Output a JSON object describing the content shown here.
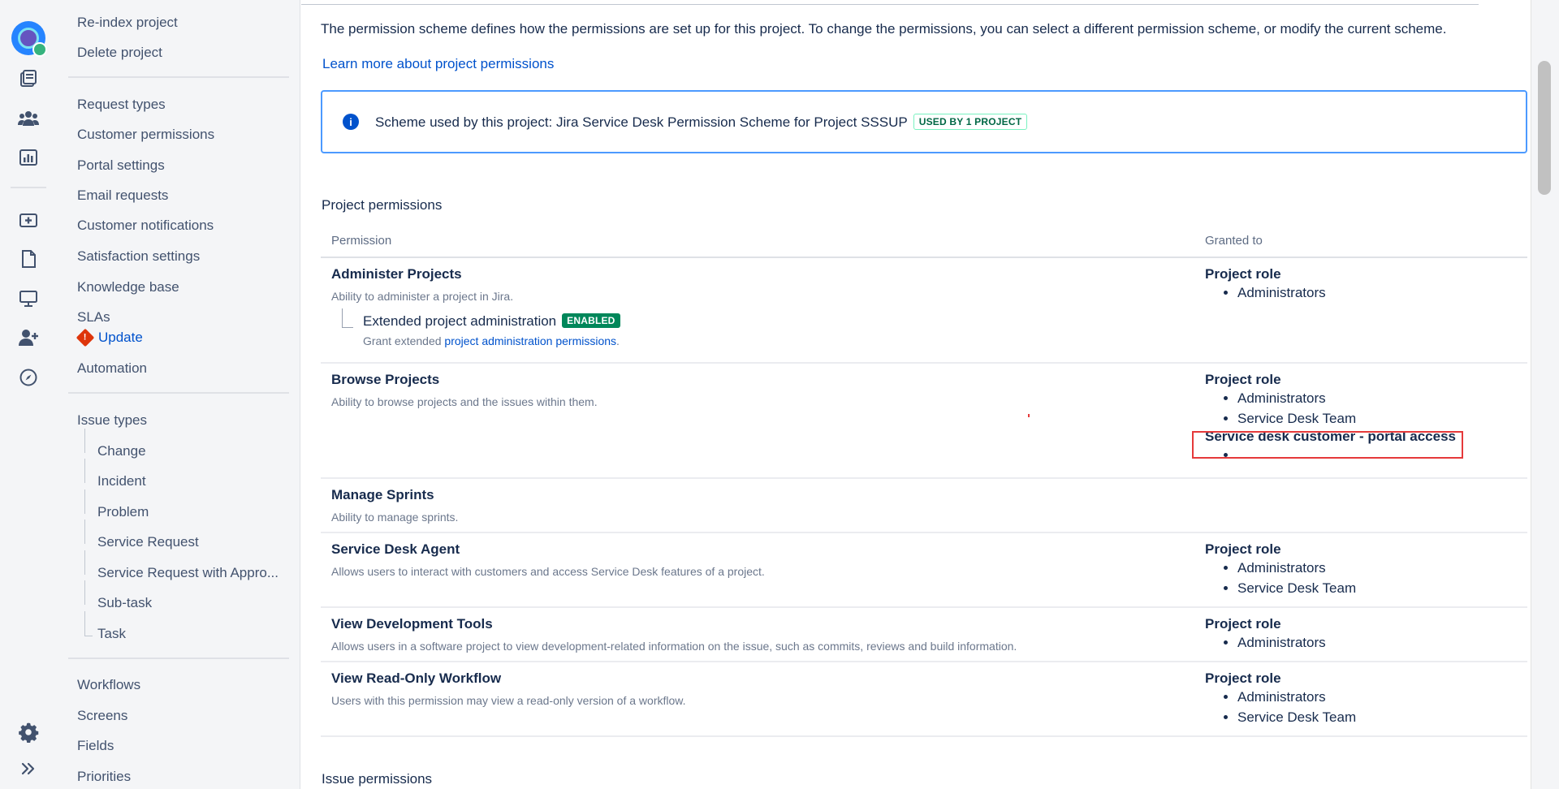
{
  "rail": {
    "icons": [
      "project-avatar-icon",
      "issues-icon",
      "queues-people-icon",
      "reports-icon",
      "add-item-icon",
      "pages-icon",
      "monitor-icon",
      "add-user-icon",
      "compass-icon",
      "settings-gear-icon",
      "expand-sidebar-icon"
    ]
  },
  "sidebar": {
    "reindex": "Re-index project",
    "delete": "Delete project",
    "request_types": "Request types",
    "customer_permissions": "Customer permissions",
    "portal_settings": "Portal settings",
    "email_requests": "Email requests",
    "customer_notifications": "Customer notifications",
    "satisfaction_settings": "Satisfaction settings",
    "knowledge_base": "Knowledge base",
    "slas": "SLAs",
    "update": "Update",
    "automation": "Automation",
    "issue_types": "Issue types",
    "issue_type_items": [
      "Change",
      "Incident",
      "Problem",
      "Service Request",
      "Service Request with Appro...",
      "Sub-task",
      "Task"
    ],
    "workflows": "Workflows",
    "screens": "Screens",
    "fields": "Fields",
    "priorities": "Priorities"
  },
  "main": {
    "description": "The permission scheme defines how the permissions are set up for this project. To change the permissions, you can select a different permission scheme, or modify the current scheme.",
    "learn_more": "Learn more about project permissions",
    "scheme_text": "Scheme used by this project: Jira Service Desk Permission Scheme for Project SSSUP",
    "scheme_badge": "USED BY 1 PROJECT",
    "project_permissions_title": "Project permissions",
    "issue_permissions_title": "Issue permissions",
    "col_permission": "Permission",
    "col_granted": "Granted to",
    "permissions": [
      {
        "name": "Administer Projects",
        "desc": "Ability to administer a project in Jira.",
        "role_label": "Project role",
        "roles": [
          "Administrators"
        ]
      },
      {
        "name": "Browse Projects",
        "desc": "Ability to browse projects and the issues within them.",
        "role_label": "Project role",
        "roles": [
          "Administrators",
          "Service Desk Team"
        ],
        "extra_label": "Service desk customer - portal access"
      },
      {
        "name": "Manage Sprints",
        "desc": "Ability to manage sprints."
      },
      {
        "name": "Service Desk Agent",
        "desc": "Allows users to interact with customers and access Service Desk features of a project.",
        "role_label": "Project role",
        "roles": [
          "Administrators",
          "Service Desk Team"
        ]
      },
      {
        "name": "View Development Tools",
        "desc": "Allows users in a software project to view development-related information on the issue, such as commits, reviews and build information.",
        "role_label": "Project role",
        "roles": [
          "Administrators"
        ]
      },
      {
        "name": "View Read-Only Workflow",
        "desc": "Users with this permission may view a read-only version of a workflow.",
        "role_label": "Project role",
        "roles": [
          "Administrators",
          "Service Desk Team"
        ]
      }
    ],
    "extended": {
      "name": "Extended project administration",
      "badge": "ENABLED",
      "desc_prefix": "Grant extended ",
      "desc_link": "project administration permissions",
      "desc_suffix": "."
    }
  }
}
